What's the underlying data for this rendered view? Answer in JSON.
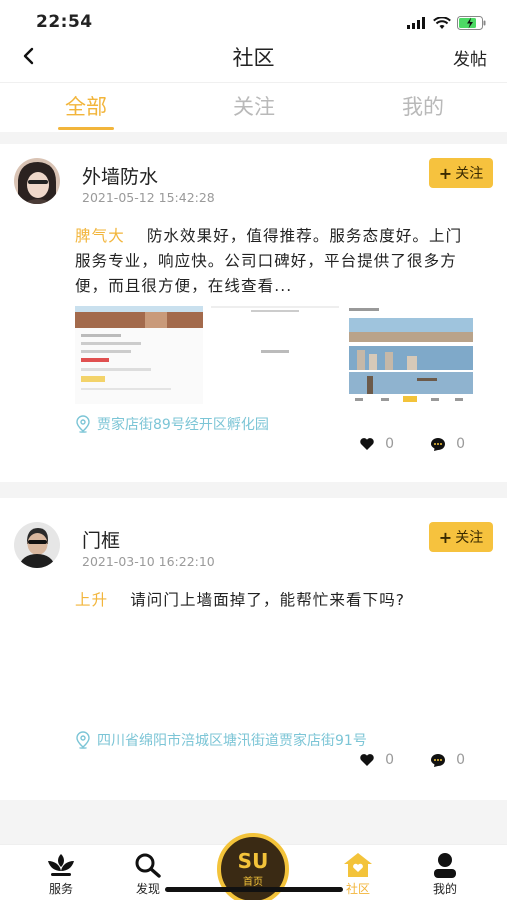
{
  "status": {
    "time": "22:54"
  },
  "nav": {
    "title": "社区",
    "post_label": "发帖"
  },
  "tabs": [
    {
      "label": "全部",
      "active": true
    },
    {
      "label": "关注",
      "active": false
    },
    {
      "label": "我的",
      "active": false
    }
  ],
  "posts": [
    {
      "author": "外墙防水",
      "date": "2021-05-12 15:42:28",
      "follow_label": "关注",
      "tag": "脾气大",
      "text": "防水效果好，值得推荐。服务态度好。上门服务专业，响应快。公司口碑好，平台提供了很多方便，而且很方便，在线查看...",
      "location": "贾家店街89号经开区孵化园",
      "likes": "0",
      "comments": "0"
    },
    {
      "author": "门框",
      "date": "2021-03-10 16:22:10",
      "follow_label": "关注",
      "tag": "上升",
      "text": "请问门上墙面掉了，能帮忙来看下吗?",
      "location": "四川省绵阳市涪城区塘汛街道贾家店街91号",
      "likes": "0",
      "comments": "0"
    }
  ],
  "tabbar": {
    "items": [
      {
        "label": "服务",
        "icon": "service-icon"
      },
      {
        "label": "发现",
        "icon": "search-icon"
      },
      {
        "label": "首页",
        "icon": "home-logo"
      },
      {
        "label": "社区",
        "icon": "community-icon"
      },
      {
        "label": "我的",
        "icon": "profile-icon"
      }
    ],
    "home_logo_text": "SU"
  },
  "colors": {
    "accent": "#f2b53b",
    "follow_bg": "#f6c23e",
    "location": "#7cc5d6"
  }
}
